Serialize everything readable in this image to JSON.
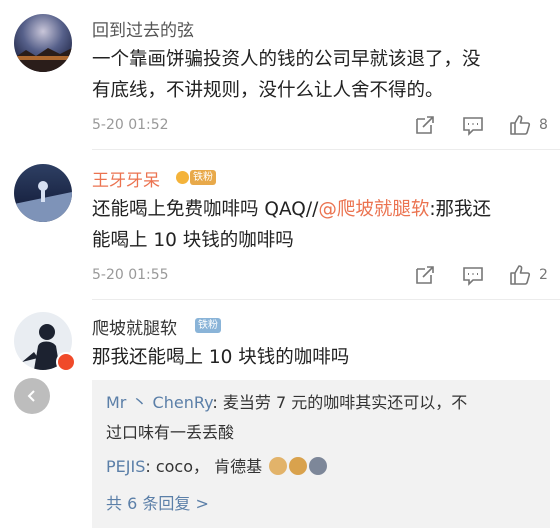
{
  "comments": [
    {
      "username": "回到过去的弦",
      "line1": "一个靠画饼骗投资人的钱的公司早就该退了，没",
      "line2": "有底线，不讲规则，没什么让人舍不得的。",
      "time": "5-20 01:52",
      "likes": "8"
    },
    {
      "username": "王牙牙呆",
      "badge": "铁粉",
      "line1_prefix": "还能喝上免费咖啡吗 QAQ//",
      "line1_mention": "@爬坡就腿软",
      "line1_suffix": ":那我还",
      "line2": "能喝上 10 块钱的咖啡吗",
      "time": "5-20 01:55",
      "likes": "2"
    },
    {
      "username": "爬坡就腿软",
      "badge": "铁粉",
      "line1": "那我还能喝上 10 块钱的咖啡吗"
    }
  ],
  "replies": {
    "r1_user": "Mr 丶 ChenRy",
    "r1_text_a": ": 麦当劳 7 元的咖啡其实还可以，不",
    "r1_text_b": "过口味有一丢丢酸",
    "r2_user": "PEJIS",
    "r2_text": ": coco， 肯德基 ",
    "r2_emojis": [
      "dog-emoji",
      "doge-emoji",
      "husky-emoji"
    ],
    "more": "共 6 条回复 >"
  },
  "icons": {
    "share": "share-icon",
    "comment": "comment-icon",
    "like": "thumbs-up-icon",
    "back": "chevron-left-icon"
  },
  "colors": {
    "accent": "#eb7350",
    "link": "#5b7fa8"
  }
}
